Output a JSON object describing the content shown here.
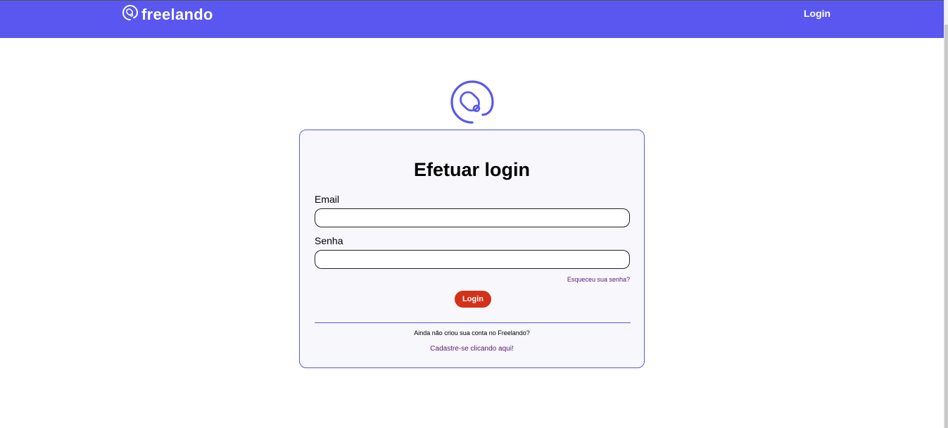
{
  "header": {
    "brand_name": "freelando",
    "login_link": "Login",
    "background_color": "#5957f0"
  },
  "login_card": {
    "title": "Efetuar login",
    "email_label": "Email",
    "email_value": "",
    "password_label": "Senha",
    "password_value": "",
    "forgot_password": "Esqueceu sua senha?",
    "login_button": "Login",
    "no_account_text": "Ainda não criou sua conta no Freelando?",
    "signup_link": "Cadastre-se clicando aqui!"
  },
  "icons": {
    "brand_logo": "freelando-logo-icon",
    "main_logo": "freelando-logo-icon"
  },
  "colors": {
    "accent": "#5957f0",
    "button": "#d4301a",
    "link": "#5a1a6e",
    "card_background": "#f8f7fc"
  }
}
